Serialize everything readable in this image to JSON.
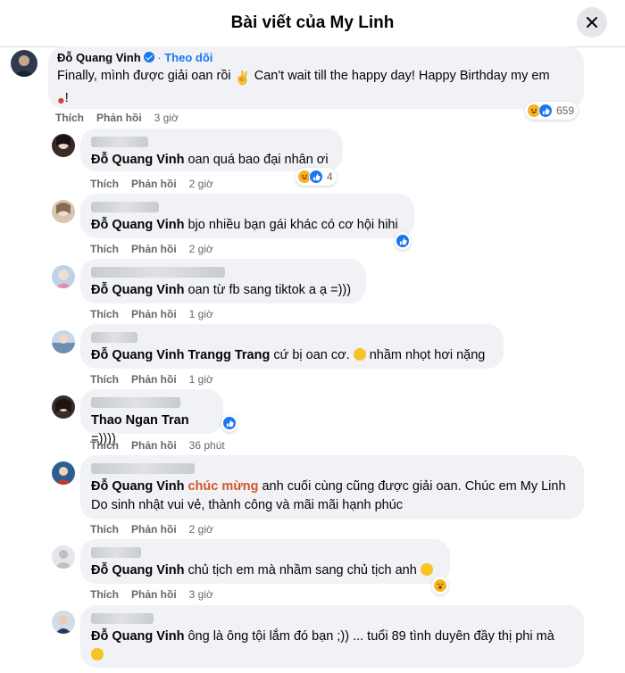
{
  "header": {
    "title": "Bài viết của My Linh"
  },
  "top_comment": {
    "author": "Đỗ Quang Vinh",
    "follow_label": "Theo dõi",
    "text_1": "Finally, mình được giải oan rồi",
    "text_2": " Can't wait till the happy day! Happy Birthday my em",
    "text_3": "!",
    "like": "Thích",
    "reply": "Phản hồi",
    "time": "3 giờ",
    "reaction_count": "659"
  },
  "comments": [
    {
      "mention": "Đỗ Quang Vinh",
      "text": " oan quá bao đại nhân ơi",
      "like": "Thích",
      "reply": "Phản hồi",
      "time": "2 giờ",
      "reaction_count": "4"
    },
    {
      "mention": "Đỗ Quang Vinh",
      "text": " bjo nhiều bạn gái khác có cơ hội hihi",
      "like": "Thích",
      "reply": "Phản hồi",
      "time": "2 giờ"
    },
    {
      "mention": "Đỗ Quang Vinh",
      "text": " oan từ fb sang tiktok a ạ =)))",
      "like": "Thích",
      "reply": "Phản hồi",
      "time": "1 giờ"
    },
    {
      "mention": "Đỗ Quang Vinh Trangg Trang",
      "text": " cứ bị oan cơ.",
      "text_after": " nhầm nhọt hơi nặng",
      "like": "Thích",
      "reply": "Phản hồi",
      "time": "1 giờ"
    },
    {
      "mention": "Thao Ngan Tran",
      "text": " =))))",
      "like": "Thích",
      "reply": "Phản hồi",
      "time": "36 phút"
    },
    {
      "mention": "Đỗ Quang Vinh",
      "highlight": "chúc mừng",
      "text": " anh cuối cùng cũng được giải oan. Chúc em My Linh",
      "text_line2": "Do sinh nhật vui vẻ, thành công và mãi mãi hạnh phúc",
      "like": "Thích",
      "reply": "Phản hồi",
      "time": "2 giờ"
    },
    {
      "mention": "Đỗ Quang Vinh",
      "text": " chủ tịch em mà nhầm sang chủ tịch anh",
      "like": "Thích",
      "reply": "Phản hồi",
      "time": "3 giờ"
    },
    {
      "mention": "Đỗ Quang Vinh",
      "text": " ông là ông tội lắm đó bạn ;)) ... tuổi 89 tình duyên đầy thị phi mà"
    }
  ],
  "colors": {
    "bubble": "#f0f2f5",
    "like_blue": "#1877f2",
    "haha_yellow": "#f7b125",
    "highlight_orange": "#d2562b"
  },
  "icons": [
    "close-icon",
    "verified-badge-icon",
    "haha-reaction-icon",
    "like-reaction-icon",
    "wow-reaction-icon",
    "default-avatar-icon"
  ]
}
